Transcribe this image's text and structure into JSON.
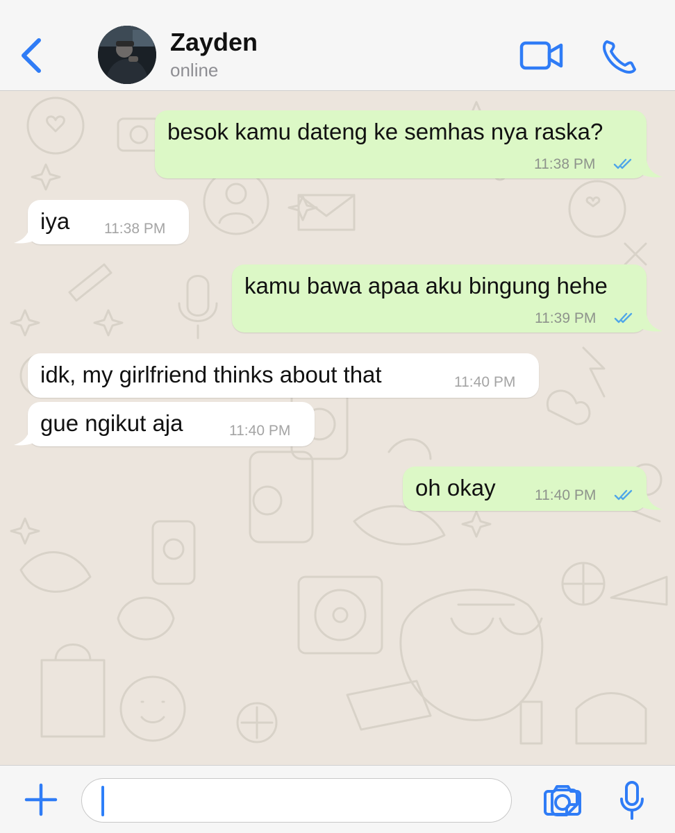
{
  "header": {
    "contact_name": "Zayden",
    "status": "online",
    "accent_color": "#2f7cf6"
  },
  "icons": [
    "chevron-left-icon",
    "video-camera-icon",
    "phone-icon",
    "plus-icon",
    "sticker-icon",
    "camera-icon",
    "microphone-icon",
    "double-check-icon"
  ],
  "messages": [
    {
      "direction": "outgoing",
      "text": "besok kamu dateng ke semhas nya raska?",
      "time": "11:38 PM",
      "read": true
    },
    {
      "direction": "incoming",
      "text": "iya",
      "time": "11:38 PM"
    },
    {
      "direction": "outgoing",
      "text": "kamu bawa apaa aku bingung hehe",
      "time": "11:39 PM",
      "read": true
    },
    {
      "direction": "incoming",
      "text": "idk, my girlfriend thinks about that",
      "time": "11:40 PM"
    },
    {
      "direction": "incoming",
      "text": "gue ngikut aja",
      "time": "11:40 PM"
    },
    {
      "direction": "outgoing",
      "text": "oh okay",
      "time": "11:40 PM",
      "read": true
    }
  ],
  "input": {
    "value": "",
    "placeholder": ""
  },
  "colors": {
    "outgoing_bubble": "#dcf8c6",
    "incoming_bubble": "#ffffff",
    "chat_background": "#ece5dd",
    "read_tick": "#4fa6e8"
  }
}
